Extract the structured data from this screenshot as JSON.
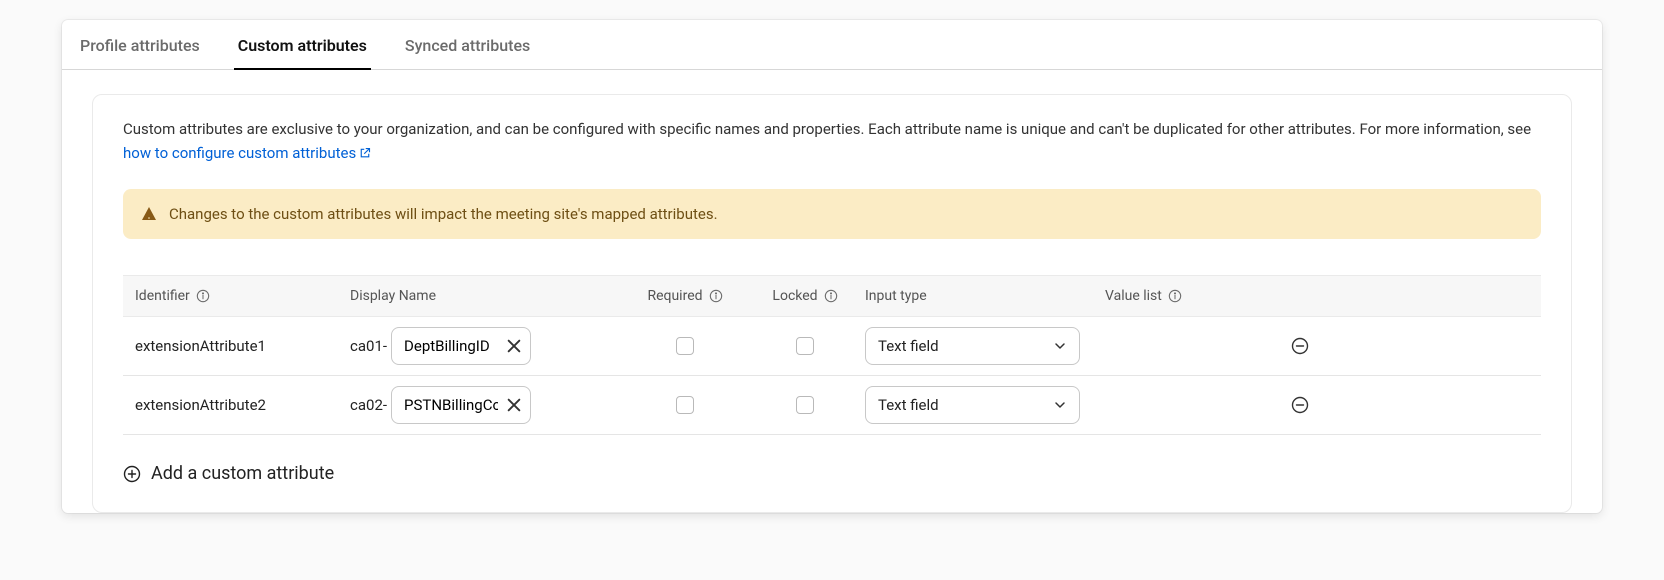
{
  "tabs": {
    "profile": "Profile attributes",
    "custom": "Custom attributes",
    "synced": "Synced attributes"
  },
  "description": {
    "text1": "Custom attributes are exclusive to your organization, and can be configured with specific names and properties. Each attribute name is unique and can't be duplicated for other attributes. For more information, see ",
    "link": "how to configure custom attributes"
  },
  "warning": "Changes to the custom attributes will impact the meeting site's mapped attributes.",
  "table": {
    "headers": {
      "identifier": "Identifier",
      "displayName": "Display Name",
      "required": "Required",
      "locked": "Locked",
      "inputType": "Input type",
      "valueList": "Value list"
    },
    "rows": [
      {
        "identifier": "extensionAttribute1",
        "prefix": "ca01-",
        "name": "DeptBillingID",
        "inputType": "Text field"
      },
      {
        "identifier": "extensionAttribute2",
        "prefix": "ca02-",
        "name": "PSTNBillingCode",
        "inputType": "Text field"
      }
    ]
  },
  "addLabel": "Add a custom attribute"
}
